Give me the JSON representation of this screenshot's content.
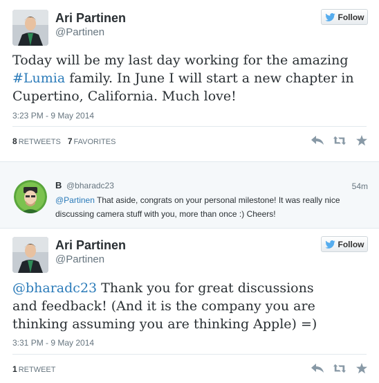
{
  "tweet1": {
    "name": "Ari Partinen",
    "handle": "@Partinen",
    "follow_label": "Follow",
    "text_before": "Today will be my last day working for the amazing ",
    "hashtag": "#Lumia",
    "text_after": " family. In June I will start a new chapter in Cupertino, California. Much love!",
    "timestamp": "3:23 PM - 9 May 2014",
    "retweets_count": "8",
    "retweets_label": "RETWEETS",
    "favorites_count": "7",
    "favorites_label": "FAVORITES"
  },
  "reply": {
    "name": "B",
    "handle": "@bharadc23",
    "time": "54m",
    "mention": "@Partinen",
    "text": " That aside, congrats on your personal milestone! It was really nice discussing camera stuff with you, more than once :) Cheers!"
  },
  "tweet2": {
    "name": "Ari Partinen",
    "handle": "@Partinen",
    "follow_label": "Follow",
    "mention": "@bharadc23",
    "text": " Thank you for great discussions and feedback! (And it is the company you are thinking assuming you are thinking Apple) =)",
    "timestamp": "3:31 PM - 9 May 2014",
    "retweets_count": "1",
    "retweets_label": "RETWEET"
  },
  "icons": {
    "follow": "twitter-bird-icon",
    "reply": "reply-icon",
    "retweet": "retweet-icon",
    "favorite": "star-icon"
  },
  "colors": {
    "link": "#2b7bb9",
    "muted": "#66757f",
    "action_icon": "#8899a6"
  }
}
